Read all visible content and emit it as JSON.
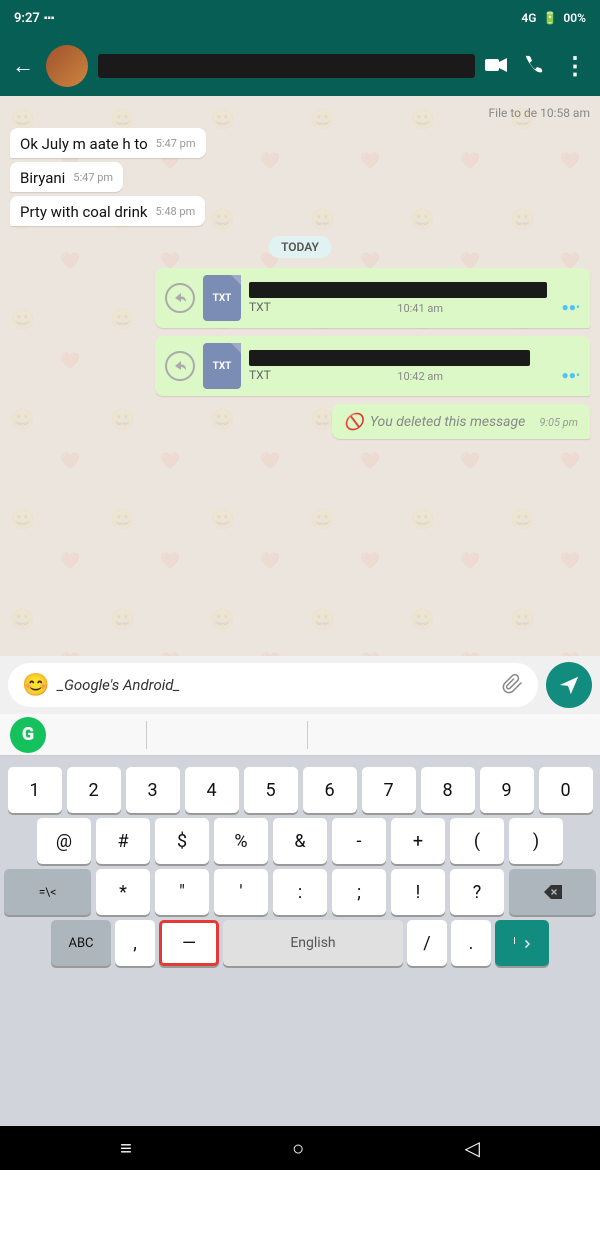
{
  "statusBar": {
    "time": "9:27",
    "signal": "4G",
    "battery": "00%"
  },
  "header": {
    "backLabel": "←",
    "chatName": "",
    "icons": {
      "video": "📹",
      "call": "📞",
      "more": "⋮"
    }
  },
  "chat": {
    "topFileLine": "File to de   10:58 am",
    "messages": [
      {
        "type": "received",
        "text": "Ok July m aate h to",
        "time": "5:47 pm"
      },
      {
        "type": "received",
        "text": "Biryani",
        "time": "5:47 pm"
      },
      {
        "type": "received",
        "text": "Prty with coal drink",
        "time": "5:48 pm"
      }
    ],
    "dayLabel": "TODAY",
    "fileMsg1": {
      "ext": "TXT",
      "time": "10:41 am"
    },
    "fileMsg2": {
      "ext": "TXT",
      "time": "10:42 am"
    },
    "deletedMsg": "You deleted this message",
    "deletedTime": "9:05 pm"
  },
  "inputBar": {
    "text": "_Google's Android_",
    "emojiIcon": "😊",
    "attachIcon": "📎",
    "sendIcon": "➤"
  },
  "keyboard": {
    "grammarly": "G",
    "row1": [
      "1",
      "2",
      "3",
      "4",
      "5",
      "6",
      "7",
      "8",
      "9",
      "0"
    ],
    "row2": [
      "@",
      "#",
      "$",
      "%",
      "&",
      "-",
      "+",
      "(",
      ")"
    ],
    "row3special": [
      "=\\<",
      "*",
      "\"",
      "'",
      ":",
      ";",
      "!",
      "?"
    ],
    "bottomRow": {
      "abc": "ABC",
      "comma": ",",
      "dash": "—",
      "spacebar": "English",
      "slash": "/",
      "period": ".",
      "enter": "↵"
    }
  },
  "navBar": {
    "menu": "≡",
    "home": "○",
    "back": "◁"
  }
}
